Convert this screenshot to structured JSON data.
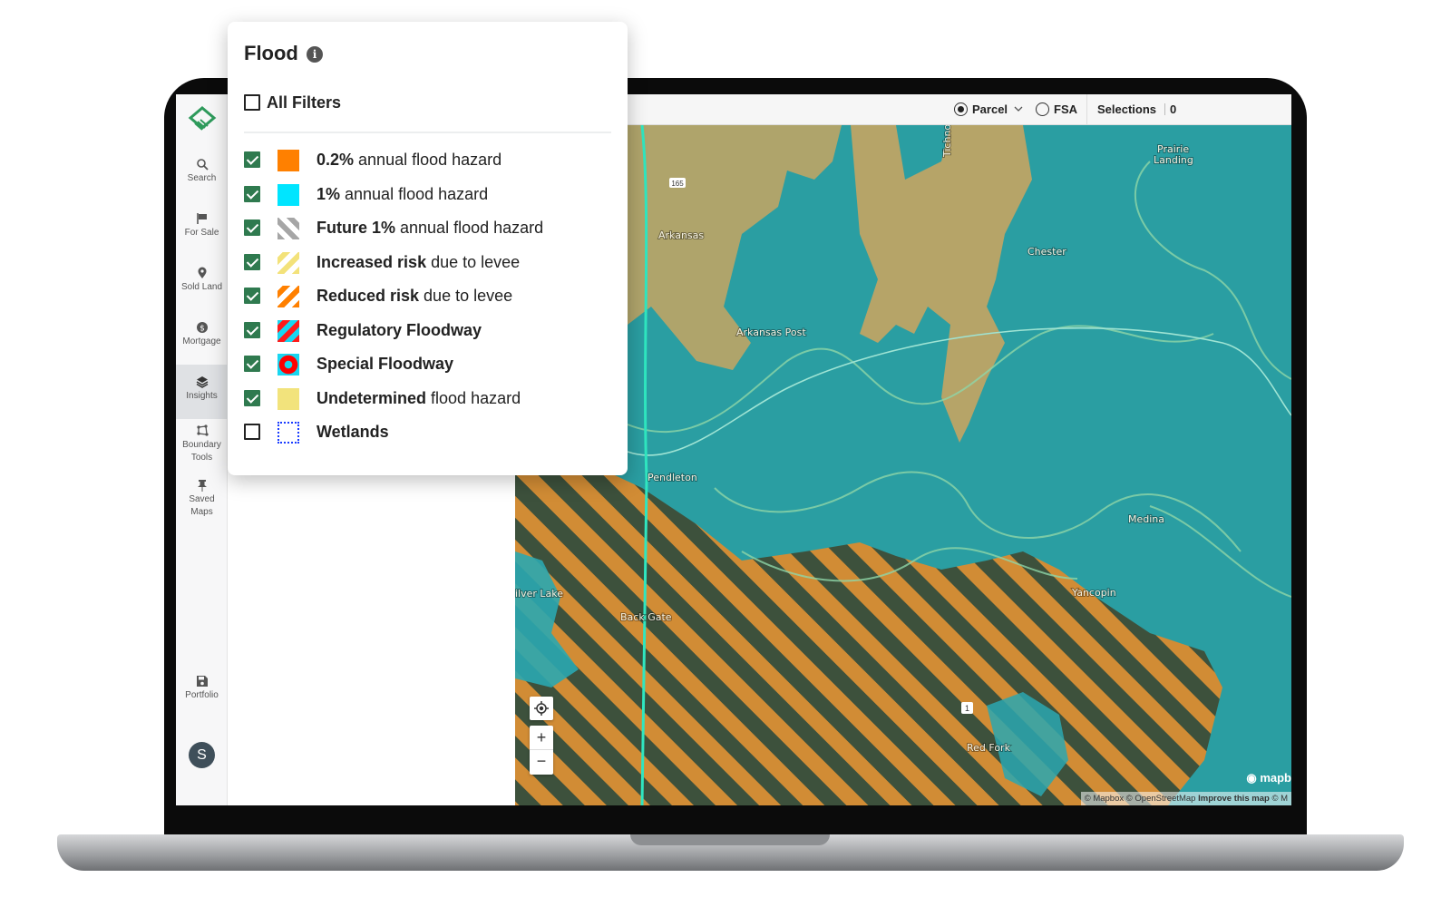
{
  "sidebar": {
    "items": [
      {
        "label": "Search",
        "icon": "search-icon"
      },
      {
        "label": "For Sale",
        "icon": "flag-icon"
      },
      {
        "label": "Sold Land",
        "icon": "location-pin-icon"
      },
      {
        "label": "Mortgage",
        "icon": "dollar-icon"
      },
      {
        "label": "Insights",
        "icon": "layers-icon",
        "active": true
      },
      {
        "label": "Boundary",
        "label2": "Tools",
        "icon": "boundary-icon"
      },
      {
        "label": "Saved",
        "label2": "Maps",
        "icon": "pin-icon"
      },
      {
        "label": "Portfolio",
        "icon": "save-icon"
      }
    ],
    "avatar": "S",
    "brand_color": "#2e9a5b"
  },
  "topbar": {
    "parcel": "Parcel",
    "fsa": "FSA",
    "selected_mode": "Parcel",
    "selections_label": "Selections",
    "selections_count": "0"
  },
  "flood_popup": {
    "title": "Flood",
    "all_filters": {
      "label": "All Filters",
      "checked": false
    },
    "filters": [
      {
        "bold": "0.2%",
        "rest": " annual flood hazard",
        "checked": true,
        "swatch": "solid-orange",
        "color": "#ff8000"
      },
      {
        "bold": "1%",
        "rest": " annual flood hazard",
        "checked": true,
        "swatch": "solid-cyan",
        "color": "#00e5ff"
      },
      {
        "bold": "Future 1%",
        "rest": " annual flood hazard",
        "checked": true,
        "swatch": "gray-hatch",
        "color": "#a6a6a6"
      },
      {
        "bold": "Increased risk",
        "rest": " due to levee",
        "checked": true,
        "swatch": "yellow-hatch",
        "color": "#f3e27a"
      },
      {
        "bold": "Reduced risk",
        "rest": " due to levee",
        "checked": true,
        "swatch": "orange-hatch",
        "color": "#ff8000"
      },
      {
        "bold": "Regulatory Floodway",
        "rest": "",
        "checked": true,
        "swatch": "red-cyan-hatch",
        "color": "#ff1a1a"
      },
      {
        "bold": "Special Floodway",
        "rest": "",
        "checked": true,
        "swatch": "red-cyan-diamond",
        "color": "#ff0000"
      },
      {
        "bold": "Undetermined",
        "rest": " flood hazard",
        "checked": true,
        "swatch": "solid-yellow",
        "color": "#f2e37c"
      },
      {
        "bold": "Wetlands",
        "rest": "",
        "checked": false,
        "swatch": "blue-dotted-box",
        "color": "#1a3cff"
      }
    ]
  },
  "map": {
    "labels": {
      "arkansas": "Arkansas",
      "chester": "Chester",
      "prairie1": "Prairie",
      "prairie2": "Landing",
      "arkansas_post": "Arkansas Post",
      "pendleton": "Pendleton",
      "medina": "Medina",
      "silver_lake": "ilver Lake",
      "back_gate": "Back Gate",
      "yancopin": "Yancopin",
      "red_fork": "Red Fork",
      "tichnor": "Tichnor Rd",
      "shield_165": "165",
      "shield_1": "1"
    },
    "zoom_in": "+",
    "zoom_out": "−",
    "logo": "mapb",
    "attribution": {
      "mapbox": "© Mapbox",
      "osm": "© OpenStreetMap",
      "improve": "Improve this map",
      "more": "© M"
    },
    "colors": {
      "water_flood": "#2a9ea2",
      "farmland": "#b9a66a",
      "hatch": "#e58a2a"
    }
  }
}
